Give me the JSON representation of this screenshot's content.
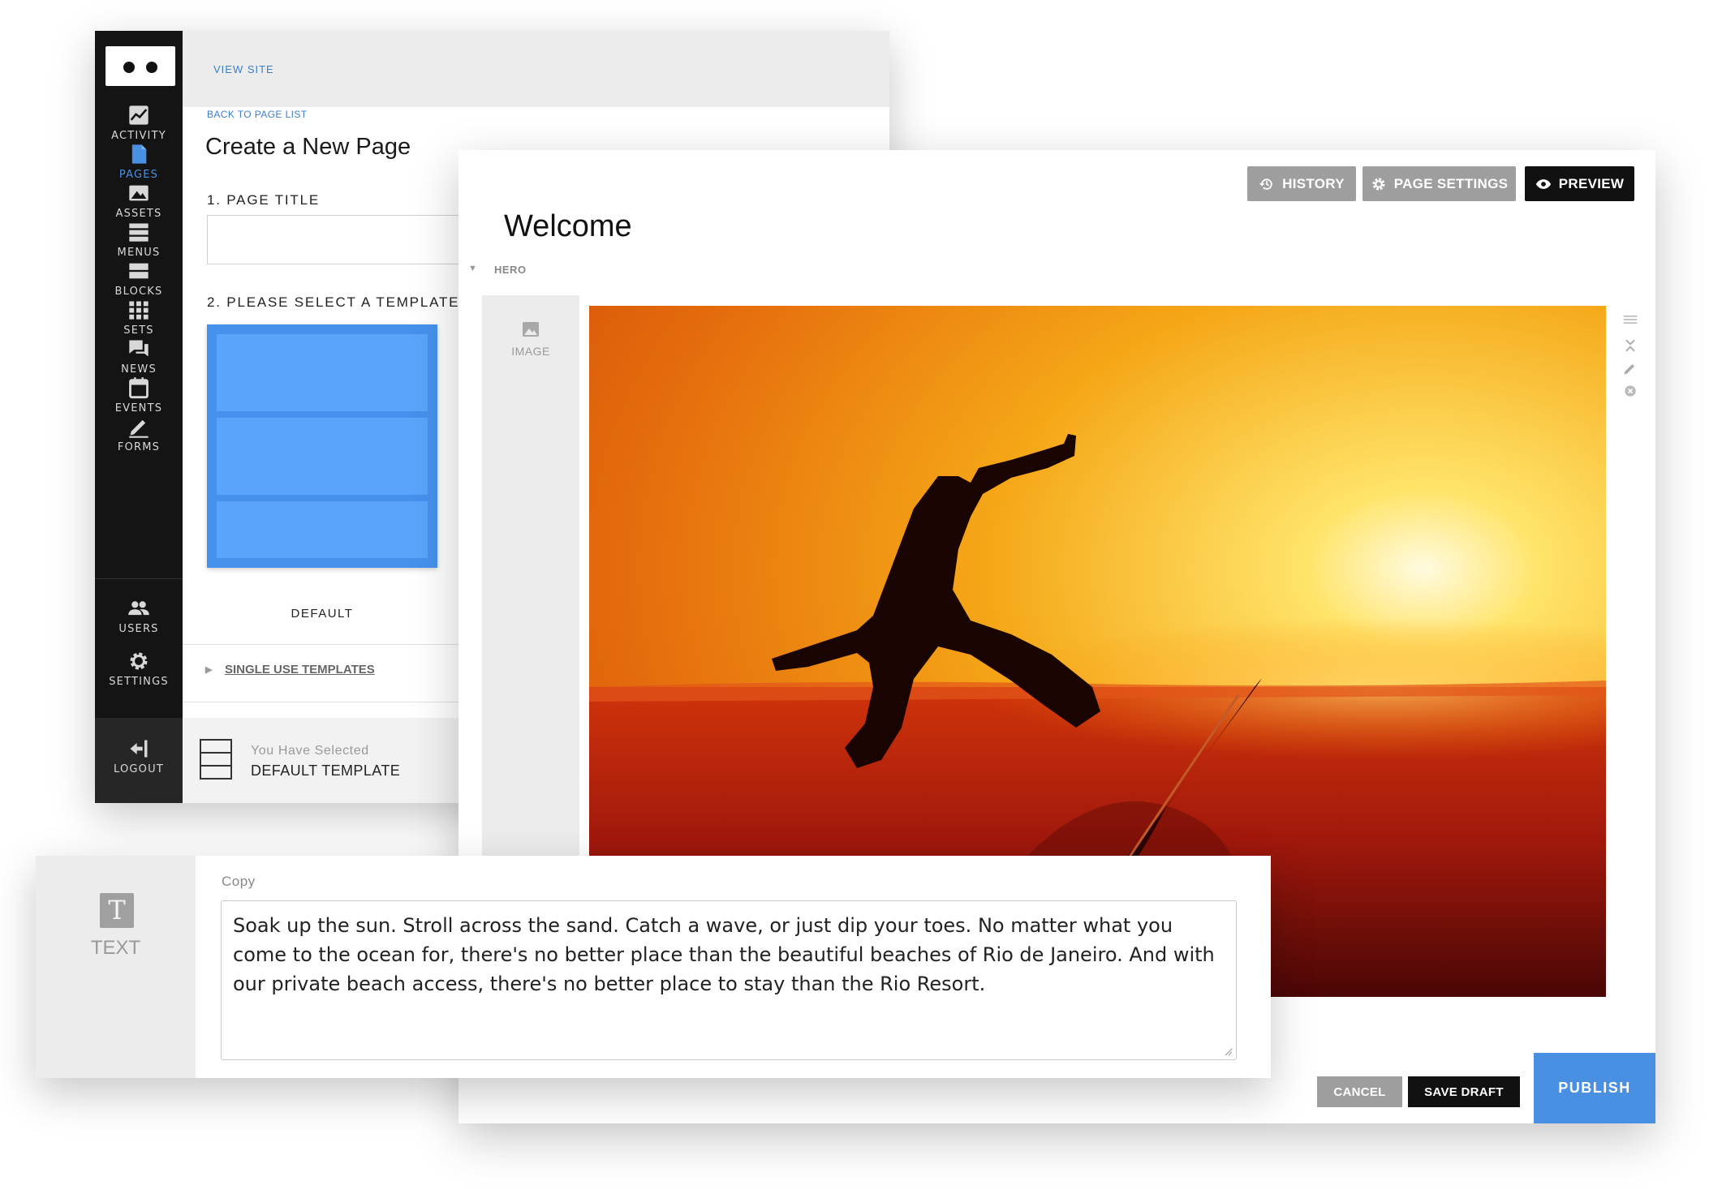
{
  "sidebar": {
    "items": [
      {
        "label": "ACTIVITY",
        "icon": "activity-icon"
      },
      {
        "label": "PAGES",
        "icon": "pages-icon"
      },
      {
        "label": "ASSETS",
        "icon": "assets-icon"
      },
      {
        "label": "MENUS",
        "icon": "menus-icon"
      },
      {
        "label": "BLOCKS",
        "icon": "blocks-icon"
      },
      {
        "label": "SETS",
        "icon": "sets-icon"
      },
      {
        "label": "NEWS",
        "icon": "news-icon"
      },
      {
        "label": "EVENTS",
        "icon": "events-icon"
      },
      {
        "label": "FORMS",
        "icon": "forms-icon"
      },
      {
        "label": "USERS",
        "icon": "users-icon"
      },
      {
        "label": "SETTINGS",
        "icon": "settings-icon"
      }
    ],
    "active_item": "PAGES",
    "logout_label": "LOGOUT",
    "accent_color": "#4a90e2"
  },
  "page_builder": {
    "view_site": "VIEW SITE",
    "back_link": "BACK TO PAGE LIST",
    "title": "Create a New Page",
    "step1_label": "1. PAGE TITLE",
    "page_title_value": "",
    "step2_label": "2. PLEASE SELECT A TEMPLATE",
    "template_name": "DEFAULT",
    "single_use_link": "SINGLE USE TEMPLATES",
    "selected_caption": "You Have Selected",
    "selected_template": "DEFAULT TEMPLATE"
  },
  "editor": {
    "history_label": "HISTORY",
    "page_settings_label": "PAGE SETTINGS",
    "preview_label": "PREVIEW",
    "page_heading": "Welcome",
    "section_label": "HERO",
    "image_block_label": "IMAGE",
    "cancel_label": "CANCEL",
    "save_draft_label": "SAVE DRAFT",
    "publish_label": "PUBLISH",
    "publish_color": "#4a90e2"
  },
  "text_block": {
    "block_label": "TEXT",
    "field_label": "Copy",
    "copy": "Soak up the sun. Stroll across the sand. Catch a wave, or just dip your toes. No matter what you come to the ocean for, there's no better place than the beautiful beaches of Rio de Janeiro. And with our private beach access, there's no better place to stay than the Rio Resort."
  }
}
